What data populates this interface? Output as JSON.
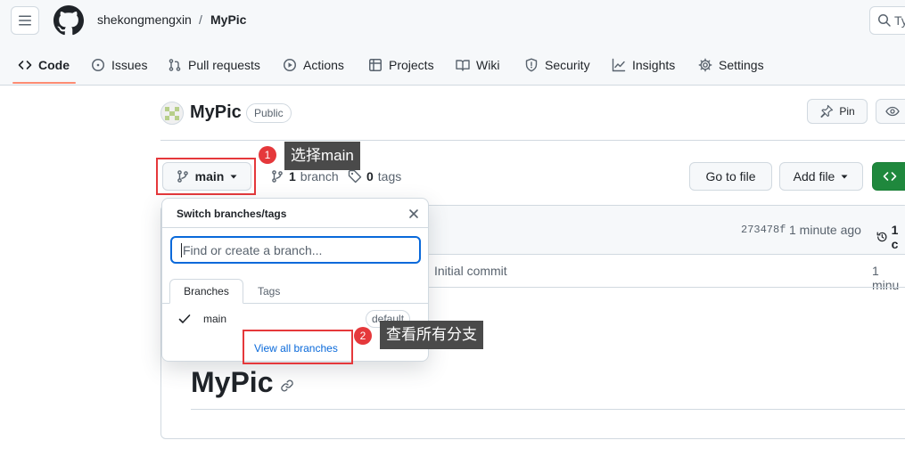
{
  "header": {
    "owner": "shekongmengxin",
    "separator": "/",
    "repo": "MyPic",
    "search_placeholder": "Ty"
  },
  "nav": {
    "code": "Code",
    "issues": "Issues",
    "pull_requests": "Pull requests",
    "actions": "Actions",
    "projects": "Projects",
    "wiki": "Wiki",
    "security": "Security",
    "insights": "Insights",
    "settings": "Settings"
  },
  "repo": {
    "name": "MyPic",
    "visibility": "Public",
    "pin_label": "Pin"
  },
  "branch_bar": {
    "current_branch": "main",
    "branch_count": "1",
    "branch_label": "branch",
    "tag_count": "0",
    "tag_label": "tags",
    "go_to_file": "Go to file",
    "add_file": "Add file"
  },
  "latest_commit": {
    "sha": "273478f",
    "time": "1 minute ago",
    "history_count": "1 c"
  },
  "files": {
    "commit_message": "Initial commit",
    "commit_time": "1 minu"
  },
  "readme": {
    "title": "MyPic"
  },
  "dropdown": {
    "title": "Switch branches/tags",
    "input_placeholder": "Find or create a branch...",
    "tab_branches": "Branches",
    "tab_tags": "Tags",
    "branch_item": "main",
    "default_badge": "default",
    "view_all": "View all branches"
  },
  "annotations": {
    "step1_number": "1",
    "step1_text": "选择main",
    "step2_number": "2",
    "step2_text": "查看所有分支"
  },
  "colors": {
    "accent_blue": "#0969da",
    "annotation_red": "#e5383b",
    "code_green": "#1f883d",
    "nav_underline": "#fd8c73"
  }
}
